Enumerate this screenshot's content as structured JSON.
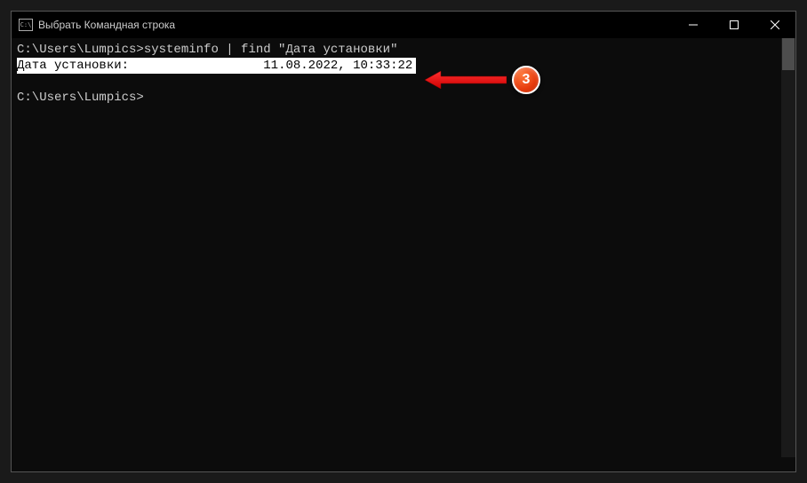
{
  "window": {
    "icon_text": "C:\\",
    "title": "Выбрать Командная строка"
  },
  "terminal": {
    "line1_prompt": "C:\\Users\\Lumpics>",
    "line1_command": "systeminfo | find \"Дата установки\"",
    "line2_label": "Дата установки:",
    "line2_spacing": "                  ",
    "line2_value": "11.08.2022, 10:33:22",
    "line3_prompt": "C:\\Users\\Lumpics>"
  },
  "annotation": {
    "step": "3"
  }
}
